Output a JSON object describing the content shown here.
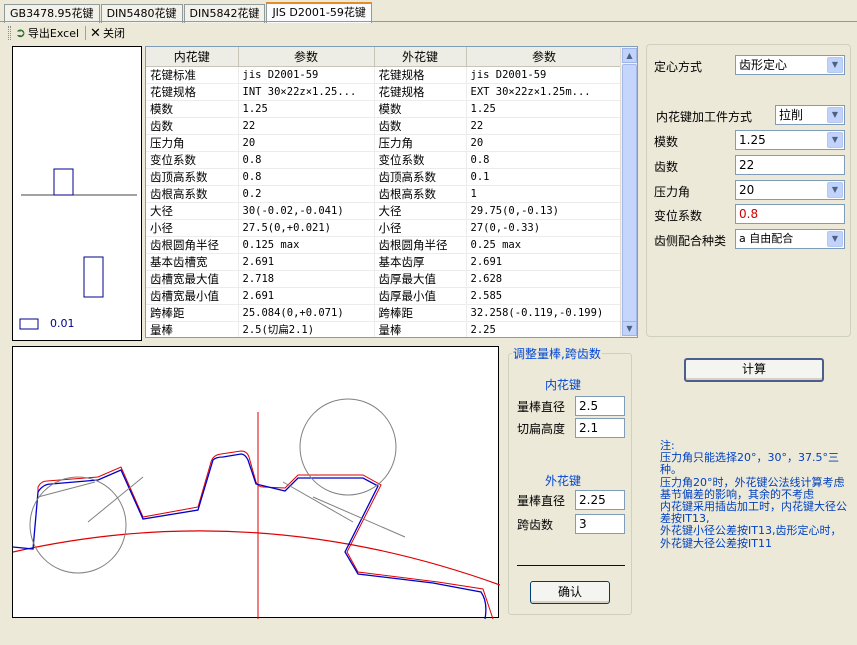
{
  "tabs": [
    {
      "label": "GB3478.95花键",
      "active": false
    },
    {
      "label": "DIN5480花键",
      "active": false
    },
    {
      "label": "DIN5842花键",
      "active": false
    },
    {
      "label": "JIS D2001-59花键",
      "active": true
    }
  ],
  "toolbar": {
    "export_label": "导出Excel",
    "close_label": "关闭"
  },
  "preview": {
    "legend_value": "0.01"
  },
  "grid": {
    "headers": [
      "内花键",
      "参数",
      "外花键",
      "参数"
    ],
    "rows": [
      [
        "花键标准",
        "jis D2001-59",
        "花键规格",
        "jis D2001-59"
      ],
      [
        "花键规格",
        "INT 30×22z×1.25...",
        "花键规格",
        "EXT 30×22z×1.25m..."
      ],
      [
        "模数",
        "1.25",
        "模数",
        "1.25"
      ],
      [
        "齿数",
        "22",
        "齿数",
        "22"
      ],
      [
        "压力角",
        "20",
        "压力角",
        "20"
      ],
      [
        "变位系数",
        "0.8",
        "变位系数",
        "0.8"
      ],
      [
        "齿顶高系数",
        "0.8",
        "齿顶高系数",
        "0.1"
      ],
      [
        "齿根高系数",
        "0.2",
        "齿根高系数",
        "1"
      ],
      [
        "大径",
        "30(-0.02,-0.041)",
        "大径",
        "29.75(0,-0.13)"
      ],
      [
        "小径",
        "27.5(0,+0.021)",
        "小径",
        "27(0,-0.33)"
      ],
      [
        "齿根圆角半径",
        "0.125 max",
        "齿根圆角半径",
        "0.25 max"
      ],
      [
        "基本齿槽宽",
        "2.691",
        "基本齿厚",
        "2.691"
      ],
      [
        "齿槽宽最大值",
        "2.718",
        "齿厚最大值",
        "2.628"
      ],
      [
        "齿槽宽最小值",
        "2.691",
        "齿厚最小值",
        "2.585"
      ],
      [
        "跨棒距",
        "25.084(0,+0.071)",
        "跨棒距",
        "32.258(-0.119,-0.199)"
      ],
      [
        "量棒",
        "2.5(切扁2.1)",
        "量棒",
        "2.25"
      ]
    ]
  },
  "settings": {
    "centering_label": "定心方式",
    "centering_value": "齿形定心",
    "method_label": "内花键加工件方式",
    "method_value": "拉削",
    "module_label": "模数",
    "module_value": "1.25",
    "teeth_label": "齿数",
    "teeth_value": "22",
    "pressure_label": "压力角",
    "pressure_value": "20",
    "shift_label": "变位系数",
    "shift_value": "0.8",
    "fit_label": "齿侧配合种类",
    "fit_value": "a 自由配合"
  },
  "adjust": {
    "title": "调整量棒,跨齿数",
    "inner_title": "内花键",
    "inner_rod_label": "量棒直径",
    "inner_rod_value": "2.5",
    "flat_label": "切扁高度",
    "flat_value": "2.1",
    "outer_title": "外花键",
    "outer_rod_label": "量棒直径",
    "outer_rod_value": "2.25",
    "span_label": "跨齿数",
    "span_value": "3",
    "confirm_label": "确认"
  },
  "calc_label": "计算",
  "note": {
    "title": "注:",
    "lines": [
      "压力角只能选择20°，30°，37.5°三种。",
      "压力角20°时，外花键公法线计算考虑基节偏差的影响，其余的不考虑",
      "内花键采用插齿加工时，内花键大径公差按IT13,",
      "外花键小径公差按IT13,齿形定心时，外花键大径公差按IT11"
    ]
  },
  "colors": {
    "accent": "#0046d5",
    "curve_blue": "#0000cc",
    "curve_red": "#e00000",
    "shift_red": "#cc0000"
  }
}
